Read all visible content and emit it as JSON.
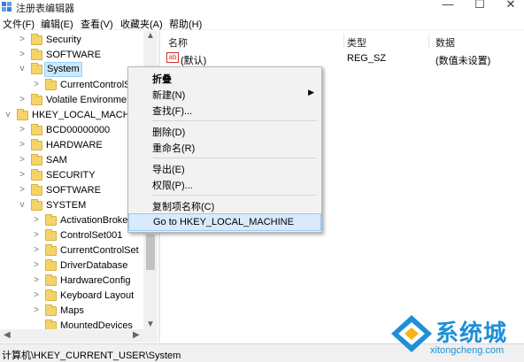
{
  "window": {
    "title": "注册表编辑器",
    "controls": {
      "minimize": "—",
      "maximize": "☐",
      "close": "✕"
    }
  },
  "menubar": {
    "items": [
      "文件(F)",
      "编辑(E)",
      "查看(V)",
      "收藏夹(A)",
      "帮助(H)"
    ]
  },
  "tree": {
    "rows": [
      {
        "label": "Security"
      },
      {
        "label": "SOFTWARE"
      },
      {
        "label": "System",
        "selected": true
      },
      {
        "label": "CurrentControlSet"
      },
      {
        "label": "Volatile Environme"
      },
      {
        "label": "HKEY_LOCAL_MACHIN"
      },
      {
        "label": "BCD00000000"
      },
      {
        "label": "HARDWARE"
      },
      {
        "label": "SAM"
      },
      {
        "label": "SECURITY"
      },
      {
        "label": "SOFTWARE"
      },
      {
        "label": "SYSTEM"
      },
      {
        "label": "ActivationBroke"
      },
      {
        "label": "ControlSet001"
      },
      {
        "label": "CurrentControlSet"
      },
      {
        "label": "DriverDatabase"
      },
      {
        "label": "HardwareConfig"
      },
      {
        "label": "Keyboard Layout"
      },
      {
        "label": "Maps"
      },
      {
        "label": "MountedDevices"
      }
    ]
  },
  "list": {
    "columns": [
      "名称",
      "类型",
      "数据"
    ],
    "rows": [
      {
        "icon": "ab",
        "name": "(默认)",
        "type": "REG_SZ",
        "data": "(数值未设置)"
      }
    ]
  },
  "context_menu": {
    "items": [
      {
        "label": "折叠"
      },
      {
        "label": "新建(N)"
      },
      {
        "label": "查找(F)..."
      },
      {
        "label": "删除(D)"
      },
      {
        "label": "重命名(R)"
      },
      {
        "label": "导出(E)"
      },
      {
        "label": "权限(P)..."
      },
      {
        "label": "复制项名称(C)"
      },
      {
        "label": "Go to HKEY_LOCAL_MACHINE"
      }
    ],
    "submenu_arrow": "▶"
  },
  "status_bar": {
    "path": "计算机\\HKEY_CURRENT_USER\\System"
  },
  "watermark": {
    "brand": "系统城",
    "url": "xitongcheng.com"
  },
  "colors": {
    "selection": "#cce8ff",
    "menu_highlight": "#d8eafc",
    "folder": "#f4d46a",
    "watermark": "#1e8fd8"
  }
}
